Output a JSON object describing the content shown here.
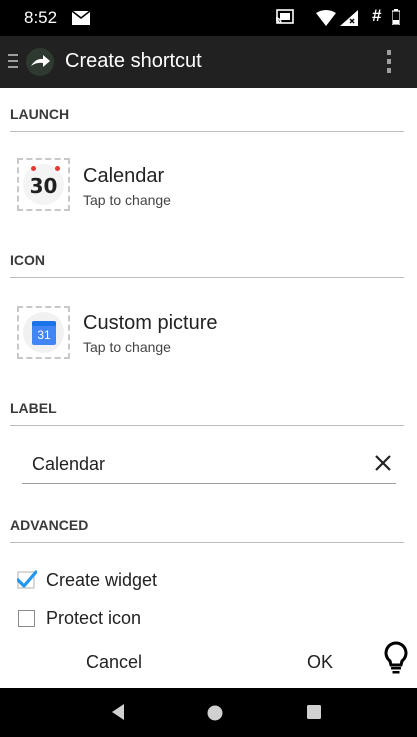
{
  "status_bar": {
    "time": "8:52",
    "hash": "#"
  },
  "app_bar": {
    "title": "Create shortcut",
    "icons": [
      "drawer-icon",
      "arrow-logo-icon",
      "overflow-menu-icon"
    ]
  },
  "sections": {
    "launch": "LAUNCH",
    "icon": "ICON",
    "label": "LABEL",
    "advanced": "ADVANCED"
  },
  "launch_item": {
    "title": "Calendar",
    "subtitle": "Tap to change",
    "icon_number": "30"
  },
  "icon_item": {
    "title": "Custom picture",
    "subtitle": "Tap to change",
    "icon_number": "31"
  },
  "label_field": {
    "value": "Calendar"
  },
  "advanced": {
    "create_widget": {
      "label": "Create widget",
      "checked": true
    },
    "protect_icon": {
      "label": "Protect icon",
      "checked": false
    }
  },
  "buttons": {
    "cancel": "Cancel",
    "ok": "OK"
  },
  "colors": {
    "status_bar": "#000000",
    "app_bar": "#212121",
    "checkbox_accent": "#2196f3",
    "divider": "#bdbdbd"
  }
}
